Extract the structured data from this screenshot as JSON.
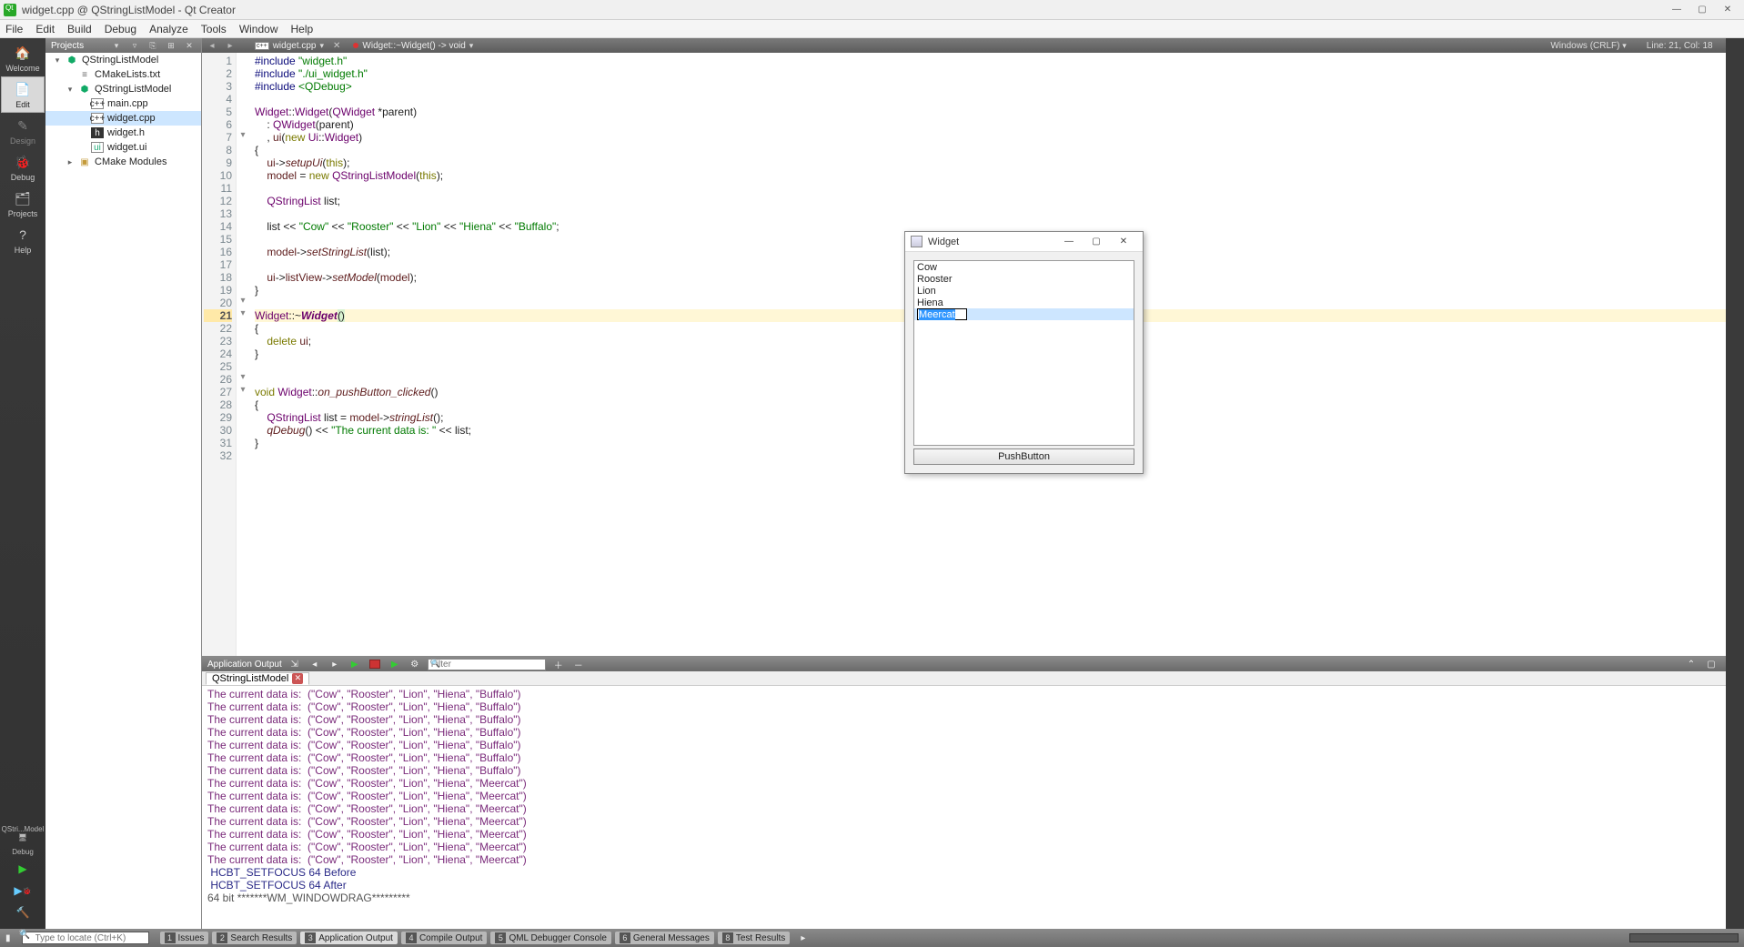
{
  "window": {
    "title": "widget.cpp @ QStringListModel - Qt Creator",
    "min": "—",
    "max": "▢",
    "close": "✕"
  },
  "menus": [
    "File",
    "Edit",
    "Build",
    "Debug",
    "Analyze",
    "Tools",
    "Window",
    "Help"
  ],
  "modes": [
    {
      "label": "Welcome",
      "icon": "🏠"
    },
    {
      "label": "Edit",
      "icon": "📄",
      "active": true
    },
    {
      "label": "Design",
      "icon": "✎",
      "dim": true
    },
    {
      "label": "Debug",
      "icon": "🐞"
    },
    {
      "label": "Projects",
      "icon": "🗂"
    },
    {
      "label": "Help",
      "icon": "?"
    }
  ],
  "kit": {
    "line1": "QStri...Model",
    "line2": "Debug"
  },
  "projectsPanel": {
    "title": "Projects",
    "tools": [
      "▾",
      "⏷",
      "⎘",
      "⊞",
      "✕"
    ],
    "tree": [
      {
        "depth": 0,
        "tw": "▾",
        "ico": "project",
        "label": "QStringListModel"
      },
      {
        "depth": 1,
        "tw": "",
        "ico": "txt",
        "label": "CMakeLists.txt"
      },
      {
        "depth": 1,
        "tw": "▾",
        "ico": "project",
        "label": "QStringListModel"
      },
      {
        "depth": 2,
        "tw": "",
        "ico": "cpp",
        "label": "main.cpp"
      },
      {
        "depth": 2,
        "tw": "",
        "ico": "cpp",
        "label": "widget.cpp",
        "sel": true
      },
      {
        "depth": 2,
        "tw": "",
        "ico": "h",
        "label": "widget.h"
      },
      {
        "depth": 2,
        "tw": "",
        "ico": "ui",
        "label": "widget.ui"
      },
      {
        "depth": 1,
        "tw": "▸",
        "ico": "folder",
        "label": "CMake Modules"
      }
    ]
  },
  "editorTabs": {
    "doc": "widget.cpp",
    "symbol": "Widget::~Widget() -> void",
    "encoding": "Windows (CRLF)",
    "pos": "Line: 21, Col: 18"
  },
  "code": {
    "current": 21,
    "lines": [
      {
        "n": 1,
        "html": "<span class='k-pp'>#include</span> <span class='k-str'>\"widget.h\"</span>"
      },
      {
        "n": 2,
        "html": "<span class='k-pp'>#include</span> <span class='k-str'>\"./ui_widget.h\"</span>"
      },
      {
        "n": 3,
        "html": "<span class='k-pp'>#include</span> <span class='k-str'>&lt;QDebug&gt;</span>"
      },
      {
        "n": 4,
        "html": ""
      },
      {
        "n": 5,
        "html": "<span class='k-ty'>Widget</span>::<span class='k-ty'>Widget</span>(<span class='k-ty'>QWidget</span> *parent)"
      },
      {
        "n": 6,
        "html": "    : <span class='k-ty'>QWidget</span>(parent)"
      },
      {
        "n": 7,
        "fold": "▾",
        "html": "    , <span class='k-mem'>ui</span>(<span class='k-kw'>new</span> <span class='k-ty'>Ui</span>::<span class='k-ty'>Widget</span>)"
      },
      {
        "n": 8,
        "html": "{"
      },
      {
        "n": 9,
        "html": "    <span class='k-mem'>ui</span>-&gt;<span class='k-fn'>setupUi</span>(<span class='k-kw'>this</span>);"
      },
      {
        "n": 10,
        "html": "    <span class='k-mem'>model</span> = <span class='k-kw'>new</span> <span class='k-ty'>QStringListModel</span>(<span class='k-kw'>this</span>);"
      },
      {
        "n": 11,
        "html": ""
      },
      {
        "n": 12,
        "html": "    <span class='k-ty'>QStringList</span> list;"
      },
      {
        "n": 13,
        "html": ""
      },
      {
        "n": 14,
        "html": "    list &lt;&lt; <span class='k-str'>\"Cow\"</span> &lt;&lt; <span class='k-str'>\"Rooster\"</span> &lt;&lt; <span class='k-str'>\"Lion\"</span> &lt;&lt; <span class='k-str'>\"Hiena\"</span> &lt;&lt; <span class='k-str'>\"Buffalo\"</span>;"
      },
      {
        "n": 15,
        "html": ""
      },
      {
        "n": 16,
        "html": "    <span class='k-mem'>model</span>-&gt;<span class='k-fn'>setStringList</span>(list);"
      },
      {
        "n": 17,
        "html": ""
      },
      {
        "n": 18,
        "html": "    <span class='k-mem'>ui</span>-&gt;<span class='k-mem'>listView</span>-&gt;<span class='k-fn k-it'>setModel</span>(<span class='k-mem'>model</span>);"
      },
      {
        "n": 19,
        "html": "}"
      },
      {
        "n": 20,
        "fold": "▾",
        "html": ""
      },
      {
        "n": 21,
        "fold": "▾",
        "html": "<span class='k-ty'>Widget</span>::~<span class='k-ty k-it'><b>Widget</b></span><span style='background:#d9f2d0;'>()</span>"
      },
      {
        "n": 22,
        "html": "{"
      },
      {
        "n": 23,
        "html": "    <span class='k-kw'>delete</span> <span class='k-mem'>ui</span>;"
      },
      {
        "n": 24,
        "html": "}"
      },
      {
        "n": 25,
        "html": ""
      },
      {
        "n": 26,
        "fold": "▾",
        "html": ""
      },
      {
        "n": 27,
        "fold": "▾",
        "html": "<span class='k-kw'>void</span> <span class='k-ty'>Widget</span>::<span class='k-fn'>on_pushButton_clicked</span>()"
      },
      {
        "n": 28,
        "html": "{"
      },
      {
        "n": 29,
        "html": "    <span class='k-ty'>QStringList</span> list = <span class='k-mem'>model</span>-&gt;<span class='k-fn'>stringList</span>();"
      },
      {
        "n": 30,
        "html": "    <span class='k-fn'>qDebug</span>() &lt;&lt; <span class='k-str'>\"The current data is: \"</span> &lt;&lt; list;"
      },
      {
        "n": 31,
        "html": "}"
      },
      {
        "n": 32,
        "html": ""
      }
    ]
  },
  "outputHeader": {
    "title": "Application Output",
    "filterPlaceholder": "Filter"
  },
  "outputTab": "QStringListModel",
  "outputLines": [
    "The current data is:  (\"Cow\", \"Rooster\", \"Lion\", \"Hiena\", \"Buffalo\")",
    "The current data is:  (\"Cow\", \"Rooster\", \"Lion\", \"Hiena\", \"Buffalo\")",
    "The current data is:  (\"Cow\", \"Rooster\", \"Lion\", \"Hiena\", \"Buffalo\")",
    "The current data is:  (\"Cow\", \"Rooster\", \"Lion\", \"Hiena\", \"Buffalo\")",
    "The current data is:  (\"Cow\", \"Rooster\", \"Lion\", \"Hiena\", \"Buffalo\")",
    "The current data is:  (\"Cow\", \"Rooster\", \"Lion\", \"Hiena\", \"Buffalo\")",
    "The current data is:  (\"Cow\", \"Rooster\", \"Lion\", \"Hiena\", \"Buffalo\")",
    "The current data is:  (\"Cow\", \"Rooster\", \"Lion\", \"Hiena\", \"Meercat\")",
    "The current data is:  (\"Cow\", \"Rooster\", \"Lion\", \"Hiena\", \"Meercat\")",
    "The current data is:  (\"Cow\", \"Rooster\", \"Lion\", \"Hiena\", \"Meercat\")",
    "The current data is:  (\"Cow\", \"Rooster\", \"Lion\", \"Hiena\", \"Meercat\")",
    "The current data is:  (\"Cow\", \"Rooster\", \"Lion\", \"Hiena\", \"Meercat\")",
    "The current data is:  (\"Cow\", \"Rooster\", \"Lion\", \"Hiena\", \"Meercat\")",
    "The current data is:  (\"Cow\", \"Rooster\", \"Lion\", \"Hiena\", \"Meercat\")",
    " HCBT_SETFOCUS 64 Before",
    " HCBT_SETFOCUS 64 After",
    "64 bit *******WM_WINDOWDRAG*********"
  ],
  "dialog": {
    "title": "Widget",
    "items": [
      "Cow",
      "Rooster",
      "Lion",
      "Hiena"
    ],
    "editing": "Meercat",
    "button": "PushButton"
  },
  "statusTabs": [
    {
      "n": "1",
      "label": "Issues"
    },
    {
      "n": "2",
      "label": "Search Results"
    },
    {
      "n": "3",
      "label": "Application Output",
      "active": true
    },
    {
      "n": "4",
      "label": "Compile Output"
    },
    {
      "n": "5",
      "label": "QML Debugger Console"
    },
    {
      "n": "6",
      "label": "General Messages"
    },
    {
      "n": "8",
      "label": "Test Results"
    }
  ],
  "locatorPlaceholder": "Type to locate (Ctrl+K)"
}
